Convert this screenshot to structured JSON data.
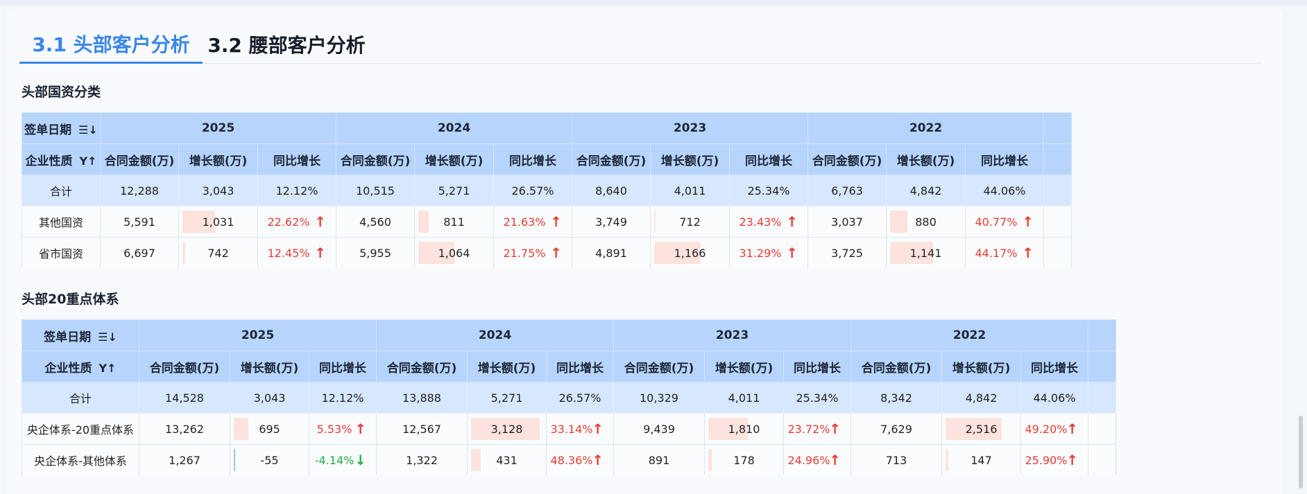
{
  "tabs": [
    {
      "label": "3.1 头部客户分析"
    },
    {
      "label": "3.2 腰部客户分析"
    }
  ],
  "section1": {
    "title": "头部国资分类",
    "date_header": "签单日期",
    "type_header": "企业性质",
    "date_sort_icon": "sort-descending-icon",
    "type_sort_icon": "filter-sort-icon",
    "years": [
      "2025",
      "2024",
      "2023",
      "2022"
    ],
    "metric_headers": [
      "合同金额(万)",
      "增长额(万)",
      "同比增长"
    ],
    "rows": [
      {
        "name": "合计",
        "is_total": true,
        "cells": [
          {
            "amount": "12,288",
            "growth": "3,043",
            "yoy": "12.12%"
          },
          {
            "amount": "10,515",
            "growth": "5,271",
            "yoy": "26.57%"
          },
          {
            "amount": "8,640",
            "growth": "4,011",
            "yoy": "25.34%"
          },
          {
            "amount": "6,763",
            "growth": "4,842",
            "yoy": "44.06%"
          }
        ]
      },
      {
        "name": "其他国资",
        "is_total": false,
        "cells": [
          {
            "amount": "5,591",
            "growth": "1,031",
            "growth_bar": 0.45,
            "yoy": "22.62%",
            "dir": "up"
          },
          {
            "amount": "4,560",
            "growth": "811",
            "growth_bar": 0.14,
            "yoy": "21.63%",
            "dir": "up"
          },
          {
            "amount": "3,749",
            "growth": "712",
            "growth_bar": 0.0,
            "yoy": "23.43%",
            "dir": "up"
          },
          {
            "amount": "3,037",
            "growth": "880",
            "growth_bar": 0.24,
            "yoy": "40.77%",
            "dir": "up"
          }
        ]
      },
      {
        "name": "省市国资",
        "is_total": false,
        "cells": [
          {
            "amount": "6,697",
            "growth": "742",
            "growth_bar": 0.04,
            "yoy": "12.45%",
            "dir": "up"
          },
          {
            "amount": "5,955",
            "growth": "1,064",
            "growth_bar": 0.5,
            "yoy": "21.75%",
            "dir": "up"
          },
          {
            "amount": "4,891",
            "growth": "1,166",
            "growth_bar": 0.64,
            "yoy": "31.29%",
            "dir": "up"
          },
          {
            "amount": "3,725",
            "growth": "1,141",
            "growth_bar": 0.6,
            "yoy": "44.17%",
            "dir": "up"
          }
        ]
      }
    ]
  },
  "section2": {
    "title": "头部20重点体系",
    "date_header": "签单日期",
    "type_header": "企业性质",
    "date_sort_icon": "sort-descending-icon",
    "type_sort_icon": "filter-sort-icon",
    "years": [
      "2025",
      "2024",
      "2023",
      "2022"
    ],
    "metric_headers": [
      "合同金额(万)",
      "增长额(万)",
      "同比增长"
    ],
    "rows": [
      {
        "name": "合计",
        "is_total": true,
        "cells": [
          {
            "amount": "14,528",
            "growth": "3,043",
            "yoy": "12.12%"
          },
          {
            "amount": "13,888",
            "growth": "5,271",
            "yoy": "26.57%"
          },
          {
            "amount": "10,329",
            "growth": "4,011",
            "yoy": "25.34%"
          },
          {
            "amount": "8,342",
            "growth": "4,842",
            "yoy": "44.06%"
          }
        ]
      },
      {
        "name": "央企体系-20重点体系",
        "is_total": false,
        "cells": [
          {
            "amount": "13,262",
            "growth": "695",
            "growth_bar": 0.2,
            "yoy": "5.53%",
            "dir": "up"
          },
          {
            "amount": "12,567",
            "growth": "3,128",
            "growth_bar": 0.95,
            "yoy": "33.14%",
            "dir": "up"
          },
          {
            "amount": "9,439",
            "growth": "1,810",
            "growth_bar": 0.55,
            "yoy": "23.72%",
            "dir": "up"
          },
          {
            "amount": "7,629",
            "growth": "2,516",
            "growth_bar": 0.78,
            "yoy": "49.20%",
            "dir": "up"
          }
        ]
      },
      {
        "name": "央企体系-其他体系",
        "is_total": false,
        "cells": [
          {
            "amount": "1,267",
            "growth": "-55",
            "growth_bar": 0.01,
            "yoy": "-4.14%",
            "dir": "down"
          },
          {
            "amount": "1,322",
            "growth": "431",
            "growth_bar": 0.13,
            "yoy": "48.36%",
            "dir": "up"
          },
          {
            "amount": "891",
            "growth": "178",
            "growth_bar": 0.05,
            "yoy": "24.96%",
            "dir": "up"
          },
          {
            "amount": "713",
            "growth": "147",
            "growth_bar": 0.04,
            "yoy": "25.90%",
            "dir": "up"
          }
        ]
      }
    ]
  }
}
